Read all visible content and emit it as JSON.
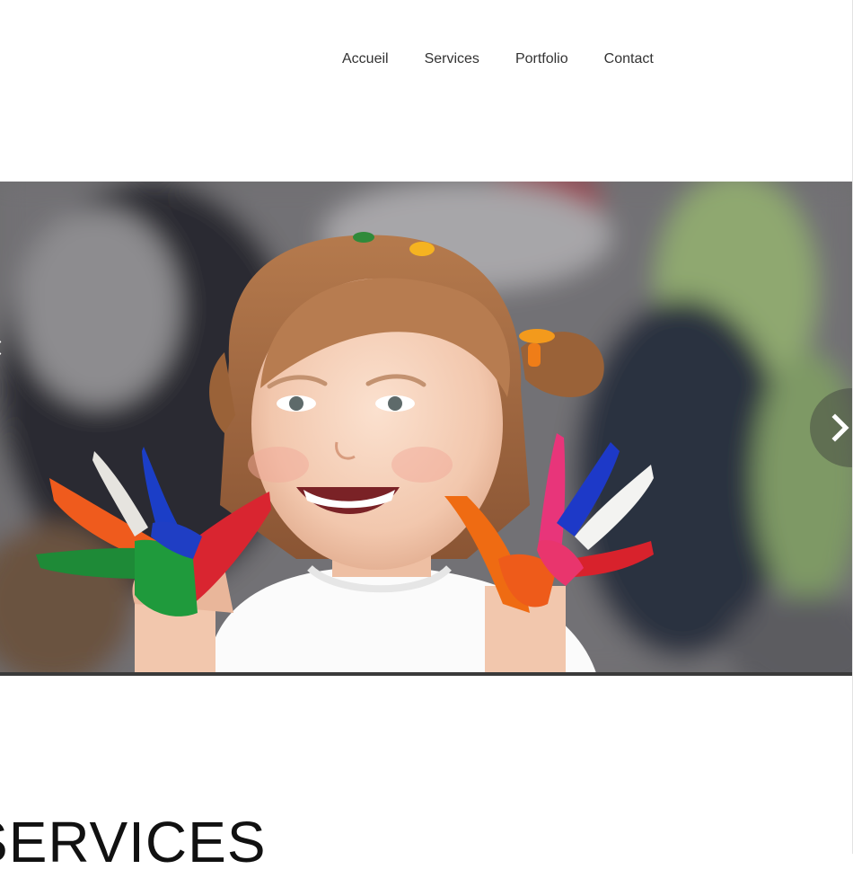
{
  "nav": {
    "items": [
      {
        "label": "Accueil"
      },
      {
        "label": "Services"
      },
      {
        "label": "Portfolio"
      },
      {
        "label": "Contact"
      }
    ]
  },
  "hero": {
    "image_icon": "child-painted-hands-photo",
    "prev_icon": "chevron-left-icon",
    "next_icon": "chevron-right-icon"
  },
  "services": {
    "title": "SERVICES"
  },
  "colors": {
    "nav_text": "#333333",
    "heading": "#111111",
    "arrow_bg": "#3c3c3c"
  }
}
